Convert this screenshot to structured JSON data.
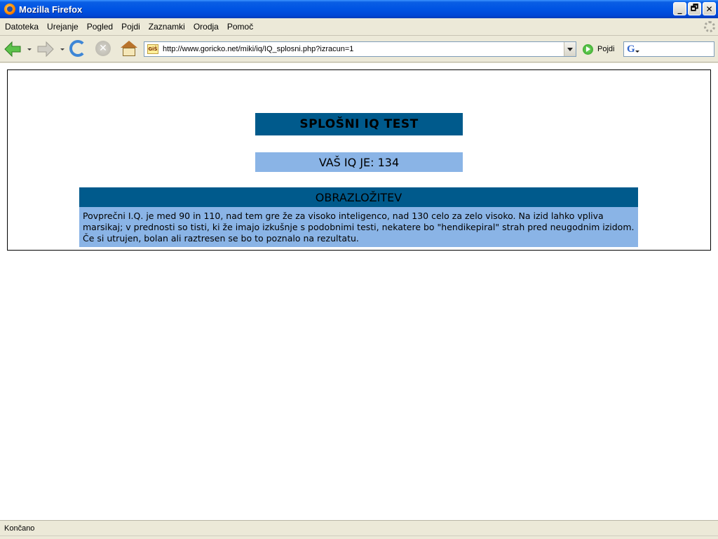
{
  "window": {
    "title": "Mozilla Firefox",
    "controls": {
      "minimize": "_",
      "maximize": "🗗",
      "close": "✕"
    }
  },
  "menu": {
    "items": [
      "Datoteka",
      "Urejanje",
      "Pogled",
      "Pojdi",
      "Zaznamki",
      "Orodja",
      "Pomoč"
    ]
  },
  "toolbar": {
    "site_icon_text": "GiŠ",
    "url": "http://www.goricko.net/miki/iq/IQ_splosni.php?izracun=1",
    "go_label": "Pojdi",
    "search_engine_letter": "G",
    "search_value": ""
  },
  "page": {
    "title": "SPLOŠNI IQ TEST",
    "result": "VAŠ IQ JE: 134",
    "explanation_header": "OBRAZLOŽITEV",
    "explanation_text": "Povprečni I.Q. je med 90 in 110, nad tem gre že za visoko inteligenco, nad 130 celo za zelo visoko. Na izid lahko vpliva marsikaj; v prednosti so tisti, ki že imajo izkušnje s podobnimi testi, nekatere bo \"hendikepiral\" strah pred neugodnim izidom. Če si utrujen, bolan ali raztresen se bo to poznalo na rezultatu."
  },
  "status": {
    "text": "Končano"
  },
  "colors": {
    "title_bg": "#005a8c",
    "result_bg": "#8ab4e6",
    "titlebar": "#0054e3"
  },
  "icons": [
    "firefox-icon",
    "back-icon",
    "forward-icon",
    "reload-icon",
    "stop-icon",
    "home-icon",
    "go-icon",
    "search-engine-icon",
    "throbber-icon"
  ]
}
